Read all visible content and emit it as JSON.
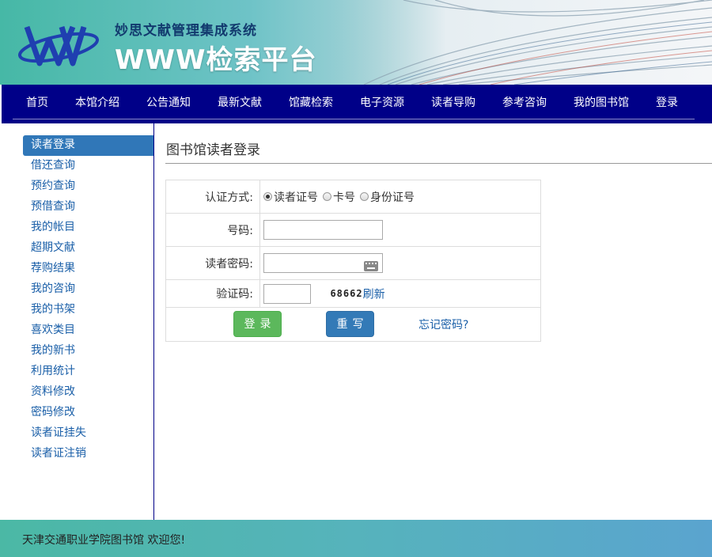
{
  "header": {
    "subtitle": "妙思文献管理集成系统",
    "title": "WWW检索平台"
  },
  "nav": {
    "items": [
      "首页",
      "本馆介绍",
      "公告通知",
      "最新文献",
      "馆藏检索",
      "电子资源",
      "读者导购",
      "参考咨询",
      "我的图书馆",
      "登录"
    ]
  },
  "sidebar": {
    "items": [
      "读者登录",
      "借还查询",
      "预约查询",
      "预借查询",
      "我的帐目",
      "超期文献",
      "荐购结果",
      "我的咨询",
      "我的书架",
      "喜欢类目",
      "我的新书",
      "利用统计",
      "资料修改",
      "密码修改",
      "读者证挂失",
      "读者证注销"
    ],
    "active_index": 0
  },
  "main": {
    "heading": "图书馆读者登录",
    "auth_label": "认证方式:",
    "auth_options": [
      "读者证号",
      "卡号",
      "身份证号"
    ],
    "auth_selected": 0,
    "number_label": "号码:",
    "number_value": "",
    "password_label": "读者密码:",
    "password_value": "",
    "captcha_label": "验证码:",
    "captcha_value": "",
    "captcha_code": "68662",
    "refresh_label": "刷新",
    "login_button": "登录",
    "reset_button": "重写",
    "forgot_link": "忘记密码?"
  },
  "footer": {
    "text": "天津交通职业学院图书馆 欢迎您!"
  },
  "colors": {
    "nav_bg": "#000088",
    "active_bg": "#3077b8",
    "link": "#1a5fa8",
    "login_btn": "#5cb85c",
    "reset_btn": "#337ab7"
  }
}
